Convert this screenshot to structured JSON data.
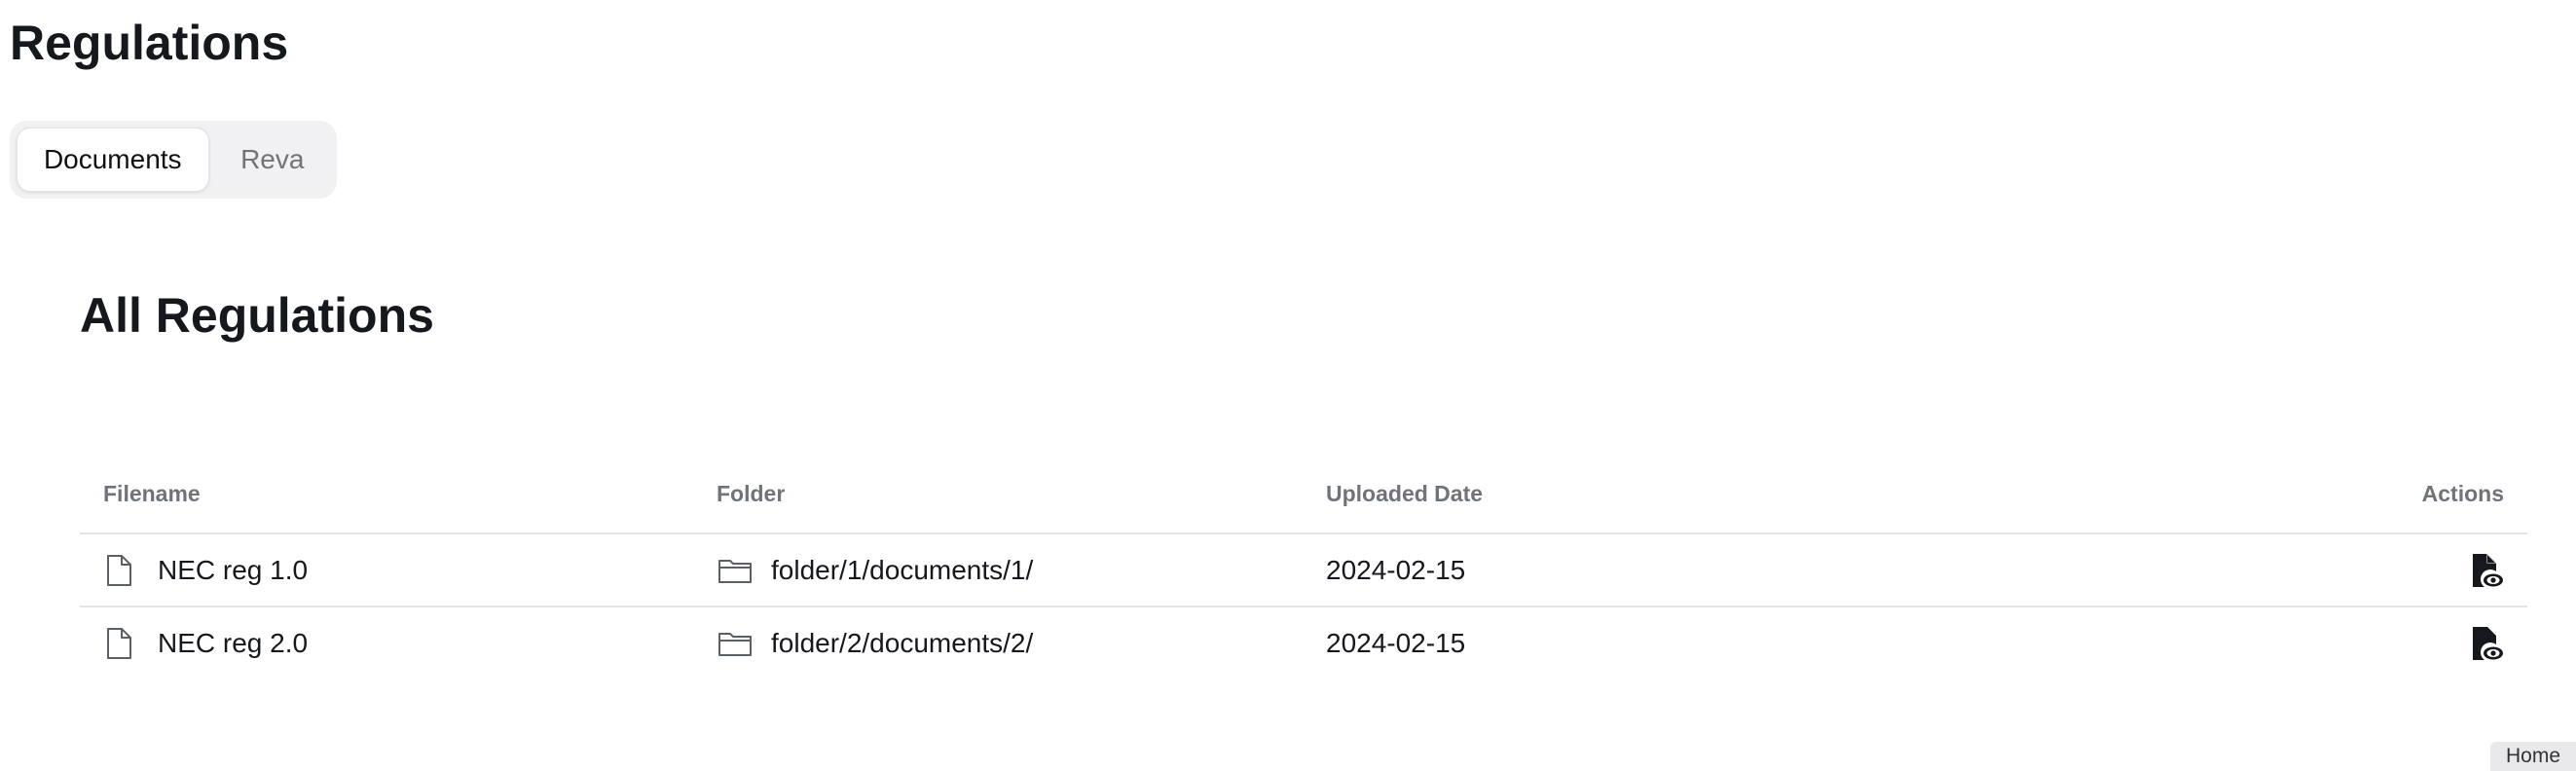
{
  "page": {
    "title": "Regulations"
  },
  "tabs": [
    {
      "label": "Documents",
      "active": true
    },
    {
      "label": "Reva",
      "active": false
    }
  ],
  "section": {
    "title": "All Regulations"
  },
  "table": {
    "columns": [
      "Filename",
      "Folder",
      "Uploaded Date",
      "Actions"
    ],
    "rows": [
      {
        "filename": "NEC reg 1.0",
        "folder": "folder/1/documents/1/",
        "uploaded_date": "2024-02-15",
        "action_icon": "view-document-icon"
      },
      {
        "filename": "NEC reg 2.0",
        "folder": "folder/2/documents/2/",
        "uploaded_date": "2024-02-15",
        "action_icon": "view-document-icon"
      }
    ]
  },
  "footer": {
    "home_label": "Home"
  },
  "colors": {
    "text": "#15181c",
    "muted": "#6f737a",
    "tab_bg": "#f1f1f3",
    "divider": "#e2e3e5"
  }
}
